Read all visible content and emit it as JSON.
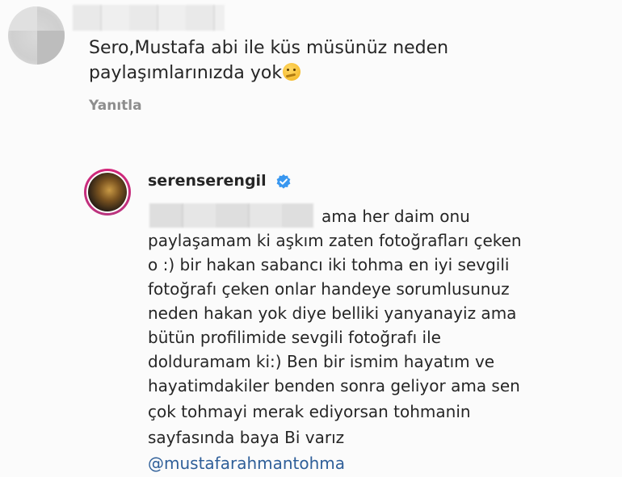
{
  "comment": {
    "text_line1": "Sero,Mustafa abi ile küs müsünüz neden",
    "text_line2": "paylaşımlarınızda yok",
    "emoji": "thinking-face",
    "reply_label": "Yanıtla"
  },
  "reply": {
    "username": "serenserengil",
    "verified": true,
    "lines": [
      "ama her daim onu",
      "paylaşamam ki aşkım  zaten fotoğrafları çeken",
      "o :) bir hakan sabancı iki tohma en iyi sevgili",
      "fotoğrafı çeken  onlar handeye sorumlusunuz",
      "neden hakan yok diye belliki yanyanayiz ama",
      "bütün profilimide sevgili fotoğrafı ile",
      "dolduramam ki:) Ben bir ismim hayatım  ve",
      "hayatimdakiler benden sonra geliyor ama sen",
      "çok tohmayi merak ediyorsan tohmanin",
      "sayfasında baya Bi varız"
    ],
    "mention": "@mustafarahmantohma"
  },
  "colors": {
    "link": "#2f5f99",
    "verified": "#3897f0",
    "muted": "#8e8e8e"
  }
}
